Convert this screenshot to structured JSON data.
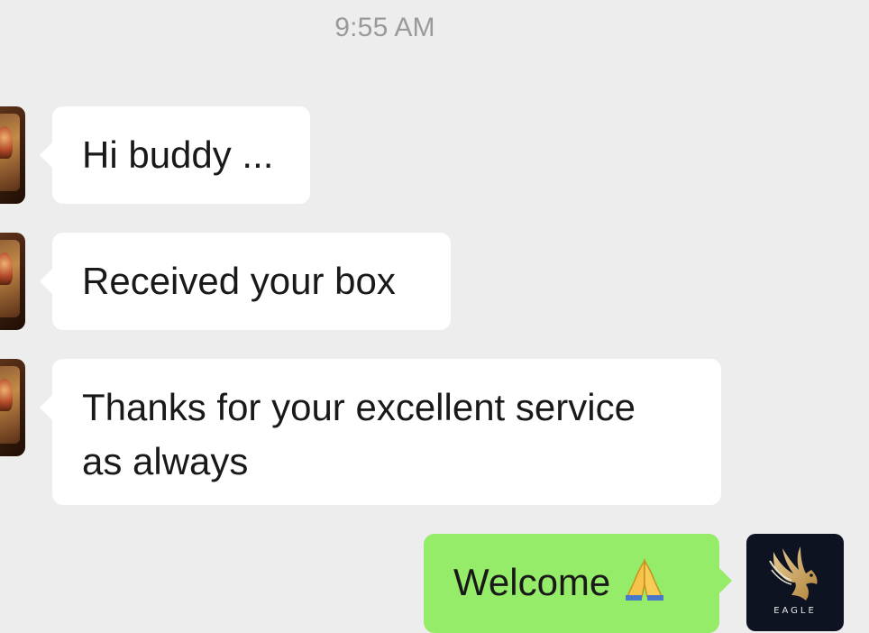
{
  "chat": {
    "timestamp": "9:55 AM",
    "messages": [
      {
        "direction": "incoming",
        "lines": [
          "Hi buddy ..."
        ]
      },
      {
        "direction": "incoming",
        "lines": [
          "Received your box"
        ]
      },
      {
        "direction": "incoming",
        "lines": [
          "Thanks for your excellent service",
          "as always"
        ]
      },
      {
        "direction": "outgoing",
        "lines": [
          "Welcome"
        ],
        "emoji": "folded-hands-icon"
      }
    ],
    "contact_avatar": {
      "icon": "person-portrait-avatar"
    },
    "own_avatar": {
      "icon": "eagle-logo-icon",
      "logo_text": "EAGLE"
    }
  },
  "colors": {
    "background": "#ededed",
    "incoming_bubble": "#ffffff",
    "outgoing_bubble": "#95ec69",
    "timestamp_text": "#9a9a9a",
    "message_text": "#191919"
  }
}
